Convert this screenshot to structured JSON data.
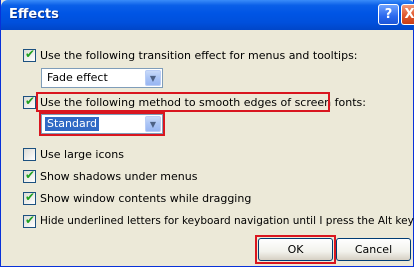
{
  "window": {
    "title": "Effects"
  },
  "titlebar_buttons": {
    "help": "?",
    "close": "X"
  },
  "transition": {
    "checked": true,
    "label": "Use the following transition effect for menus and tooltips:",
    "combo_value": "Fade effect"
  },
  "smoothing": {
    "checked": true,
    "label": "Use the following method to smooth edges of screen fonts:",
    "combo_value": "Standard"
  },
  "options": [
    {
      "label": "Use large icons",
      "checked": false
    },
    {
      "label": "Show shadows under menus",
      "checked": true
    },
    {
      "label": "Show window contents while dragging",
      "checked": true
    },
    {
      "label": "Hide underlined letters for keyboard navigation until I press the Alt key",
      "checked": true
    }
  ],
  "buttons": {
    "ok": "OK",
    "cancel": "Cancel"
  },
  "highlight_color": "#d9161f"
}
